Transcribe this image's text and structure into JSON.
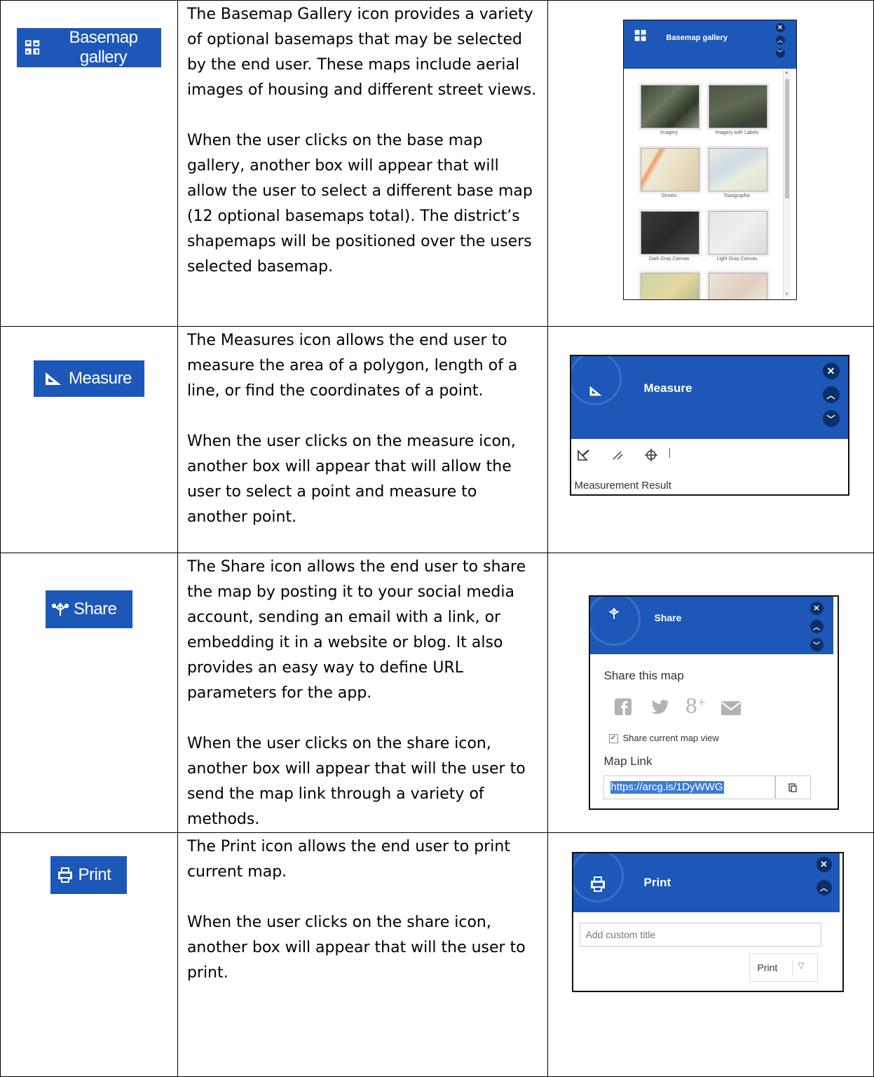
{
  "rows": [
    {
      "tool_label": "Basemap gallery",
      "paragraphs": [
        "The Basemap Gallery icon provides a variety of optional basemaps that may be selected by the end user. These maps include aerial images of housing and different street views.",
        "When the user clicks on the base map gallery, another box will appear that will allow the user to select a different base map (12 optional basemaps total). The district’s shapemaps will be positioned over the users selected basemap."
      ],
      "panel": {
        "title": "Basemap gallery",
        "thumbnails": [
          "Imagery",
          "Imagery with Labels",
          "Streets",
          "Topographic",
          "Dark Gray Canvas",
          "Light Gray Canvas"
        ]
      }
    },
    {
      "tool_label": "Measure",
      "paragraphs": [
        "The Measures icon allows the end user to measure the area of a polygon, length of a line, or find the coordinates of a point.",
        "When the user clicks on the measure icon, another box will appear that will allow the user to select a point and measure to another point."
      ],
      "panel": {
        "title": "Measure",
        "result_label": "Measurement Result"
      }
    },
    {
      "tool_label": "Share",
      "paragraphs": [
        "The Share icon allows the end user to share the map by posting it to your social media account, sending an email with a link, or embedding it in a website or blog. It also provides an easy way to define URL parameters for the app.",
        "When the user clicks on the share icon, another box will appear that will the user to send the map link through a variety of methods."
      ],
      "panel": {
        "title": "Share",
        "share_heading": "Share this map",
        "checkbox_label": "Share current map view",
        "checkbox_checked": true,
        "link_label": "Map Link",
        "link_value": "https://arcg.is/1DyWWG"
      }
    },
    {
      "tool_label": "Print",
      "paragraphs": [
        "The Print icon allows the end user to print current map.",
        "When the user clicks on the share icon, another box will appear that will the user to print."
      ],
      "panel": {
        "title": "Print",
        "title_placeholder": "Add custom title",
        "print_button": "Print"
      }
    }
  ]
}
